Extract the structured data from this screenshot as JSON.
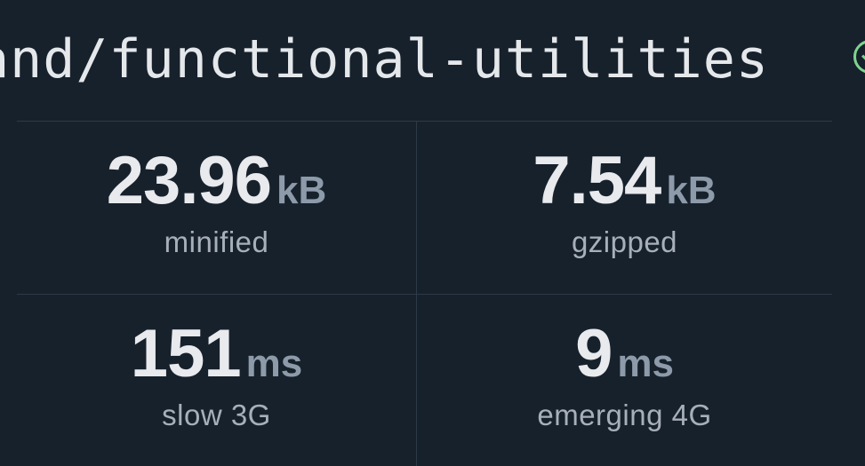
{
  "package": {
    "name_visible": "and/functional-utilities",
    "verified_icon": "check-circle-icon",
    "accent_color": "#7ed48e"
  },
  "stats": {
    "minified": {
      "value": "23.96",
      "unit": "kB",
      "label": "minified"
    },
    "gzipped": {
      "value": "7.54",
      "unit": "kB",
      "label": "gzipped"
    },
    "slow_3g": {
      "value": "151",
      "unit": "ms",
      "label": "slow 3G"
    },
    "emerging_4g": {
      "value": "9",
      "unit": "ms",
      "label": "emerging 4G"
    }
  }
}
